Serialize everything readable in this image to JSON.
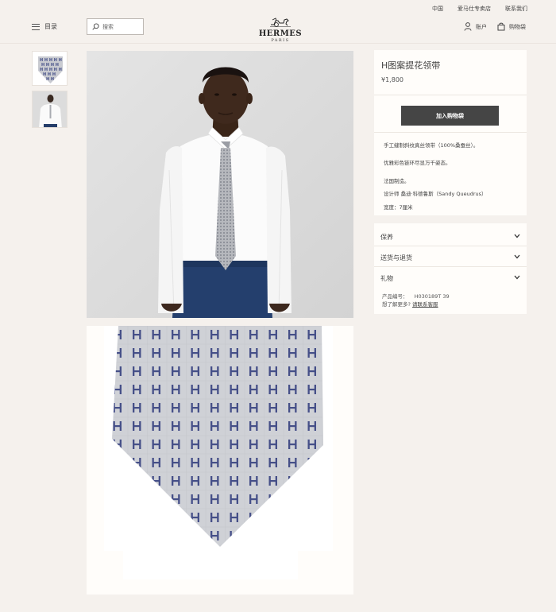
{
  "top_links": {
    "region": "中国",
    "stores": "爱马仕专卖店",
    "contact": "联系我们"
  },
  "header": {
    "menu_label": "目录",
    "search_placeholder": "搜索",
    "logo_name": "HERMES",
    "logo_city": "PARIS",
    "account_label": "账户",
    "cart_label": "购物袋"
  },
  "product": {
    "title": "H图案提花领带",
    "price": "¥1,800",
    "add_to_bag": "加入购物袋",
    "description": [
      "手工缝制斜纹真丝领带（100%桑蚕丝）。",
      "优雅彩色链环尽显万千姿态。",
      "法国制造。",
      "设计师 桑迪·科德鲁斯（Sandy Queudrus）",
      "宽度：7厘米"
    ]
  },
  "accordion": [
    {
      "label": "保养"
    },
    {
      "label": "送货与退货"
    },
    {
      "label": "礼物"
    }
  ],
  "meta": {
    "ref_label": "产品编号：",
    "ref_value": "H030189T 39",
    "more_label": "想了解更多?",
    "contact_link": "请联系客服"
  },
  "colors": {
    "background": "#f5f1ed",
    "panel": "#fffdfa",
    "button": "#454545",
    "tie_base": "#c9cbd1",
    "tie_pattern": "#454f88"
  },
  "icons": {
    "menu": "hamburger-icon",
    "search": "search-icon",
    "account": "person-icon",
    "cart": "shopping-bag-icon",
    "accordion": "chevron-down-icon"
  }
}
